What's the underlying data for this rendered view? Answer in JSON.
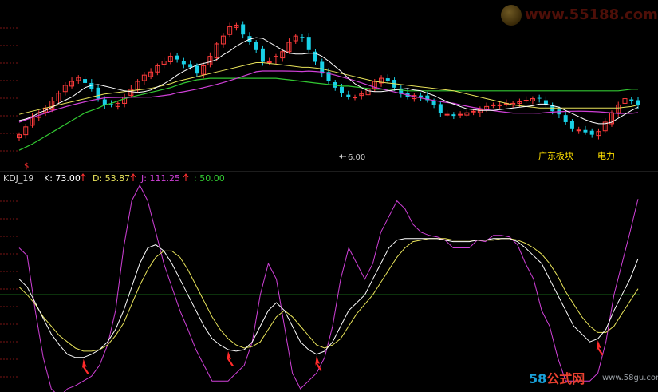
{
  "colors": {
    "background": "#000000",
    "candle_up": "#ff3b3b",
    "candle_down": "#19d0e6",
    "ma_short": "#ffffff",
    "ma_mid": "#e8e35a",
    "ma_long": "#d040d8",
    "ma_very_long": "#32c832",
    "k_line": "#ffffff",
    "d_line": "#e8e35a",
    "j_line": "#d040d8",
    "level_line": "#32c832",
    "arrow": "#ff2a2a",
    "grid": "#7a1414"
  },
  "top_chart": {
    "low_label": "6.00",
    "sector_label": "广东板块",
    "industry_label": "电力",
    "flag_icon": "dollar-flag-icon"
  },
  "kdj_header": {
    "name": "KDJ_19",
    "k_label": "K: 73.00",
    "d_label": "D: 53.87",
    "j_label": "J: 111.25",
    "level_label": ": 50.00",
    "up_arrow_icon": "up-arrow-icon"
  },
  "watermark": {
    "text": "www.55188.com"
  },
  "brand": {
    "num": "58",
    "cn": "公式网",
    "url": "www.58gu.com"
  },
  "chart_data": [
    {
      "type": "candlestick",
      "title": "",
      "xlabel": "",
      "ylabel": "",
      "annotations": [
        "6.00",
        "广东板块",
        "电力"
      ],
      "series": [
        {
          "values": [
            32,
            42,
            55,
            60,
            66,
            75,
            85,
            95,
            100,
            105,
            98,
            90,
            78,
            70,
            70,
            72,
            80,
            90,
            100,
            108,
            112,
            120,
            126,
            132,
            128,
            122,
            118,
            110,
            120,
            132,
            148,
            158,
            170,
            172,
            160,
            150,
            140,
            125,
            125,
            132,
            138,
            150,
            158,
            156,
            140,
            125,
            110,
            100,
            92,
            85,
            80,
            80,
            84,
            90,
            100,
            104,
            100,
            92,
            84,
            80,
            82,
            80,
            76,
            70,
            60,
            58,
            56,
            58,
            60,
            62,
            64,
            68,
            70,
            70,
            72,
            72,
            74,
            76,
            78,
            78,
            70,
            62,
            58,
            48,
            40,
            38,
            35,
            32,
            36,
            48,
            60,
            70,
            78,
            75,
            70
          ]
        },
        {
          "values": [
            50,
            52,
            55,
            60,
            63,
            67,
            72,
            76,
            80,
            86,
            92,
            95,
            96,
            94,
            92,
            90,
            88,
            87,
            86,
            87,
            89,
            93,
            97,
            102,
            108,
            113,
            117,
            121,
            123,
            125,
            128,
            134,
            139,
            145,
            150,
            154,
            156,
            155,
            150,
            145,
            140,
            136,
            135,
            135,
            136,
            136,
            132,
            126,
            119,
            112,
            104,
            97,
            92,
            88,
            87,
            87,
            88,
            89,
            90,
            91,
            89,
            88,
            85,
            82,
            78,
            74,
            71,
            68,
            65,
            64,
            63,
            63,
            63,
            64,
            65,
            66,
            67,
            68,
            69,
            71,
            71,
            69,
            67,
            63,
            59,
            55,
            51,
            48,
            46,
            46,
            48,
            53,
            58,
            63,
            67
          ]
        },
        {
          "values": [
            58,
            60,
            62,
            64,
            66,
            68,
            70,
            72,
            74,
            76,
            78,
            80,
            82,
            84,
            85,
            86,
            87,
            88,
            89,
            90,
            91,
            93,
            95,
            97,
            100,
            102,
            104,
            106,
            108,
            110,
            112,
            114,
            116,
            118,
            120,
            122,
            124,
            124,
            123,
            122,
            121,
            120,
            119,
            118,
            118,
            117,
            116,
            114,
            112,
            110,
            108,
            106,
            104,
            102,
            100,
            99,
            98,
            97,
            96,
            95,
            94,
            93,
            92,
            91,
            90,
            89,
            88,
            86,
            84,
            82,
            80,
            78,
            76,
            74,
            72,
            70,
            69,
            68,
            67,
            66,
            66,
            66,
            66,
            66,
            66,
            66,
            66,
            66,
            66,
            66,
            66,
            66,
            67,
            68,
            70
          ]
        },
        {
          "values": [
            12,
            16,
            20,
            25,
            30,
            35,
            40,
            45,
            50,
            55,
            60,
            63,
            66,
            70,
            72,
            75,
            78,
            80,
            82,
            84,
            86,
            88,
            90,
            92,
            95,
            98,
            100,
            102,
            103,
            104,
            104,
            104,
            104,
            104,
            104,
            104,
            104,
            104,
            104,
            104,
            103,
            102,
            101,
            100,
            99,
            98,
            97,
            96,
            95,
            94,
            94,
            93,
            92,
            91,
            90,
            90,
            90,
            90,
            89,
            88,
            88,
            88,
            88,
            88,
            88,
            88,
            88,
            88,
            88,
            88,
            88,
            88,
            88,
            88,
            88,
            88,
            88,
            88,
            88,
            88,
            88,
            88,
            88,
            88,
            88,
            88,
            88,
            88,
            88,
            88,
            88,
            88,
            89,
            90,
            90
          ]
        }
      ]
    },
    {
      "type": "line",
      "title": "",
      "xlabel": "",
      "ylabel": "",
      "ylim": [
        -10,
        120
      ],
      "annotations": [
        "KDJ_19",
        "K: 73.00",
        "D: 53.87",
        "J: 111.25",
        ": 50.00"
      ],
      "series": [
        {
          "name": "K",
          "values": [
            60,
            55,
            45,
            35,
            25,
            18,
            12,
            10,
            10,
            12,
            15,
            20,
            28,
            40,
            55,
            70,
            80,
            82,
            78,
            70,
            60,
            50,
            40,
            30,
            22,
            18,
            15,
            14,
            15,
            20,
            30,
            40,
            45,
            40,
            30,
            20,
            15,
            12,
            14,
            20,
            30,
            40,
            45,
            50,
            60,
            70,
            80,
            85,
            86,
            86,
            86,
            86,
            86,
            85,
            84,
            84,
            84,
            85,
            85,
            86,
            86,
            86,
            84,
            80,
            75,
            70,
            60,
            50,
            40,
            30,
            25,
            20,
            22,
            28,
            40,
            50,
            60,
            73
          ]
        },
        {
          "name": "D",
          "values": [
            55,
            50,
            44,
            36,
            30,
            24,
            20,
            16,
            14,
            14,
            15,
            18,
            24,
            32,
            44,
            56,
            66,
            74,
            78,
            78,
            74,
            66,
            56,
            46,
            36,
            28,
            22,
            18,
            16,
            17,
            20,
            28,
            36,
            40,
            36,
            30,
            24,
            18,
            16,
            18,
            22,
            30,
            38,
            44,
            50,
            58,
            66,
            74,
            80,
            84,
            85,
            86,
            86,
            86,
            85,
            85,
            85,
            85,
            85,
            85,
            86,
            86,
            85,
            83,
            80,
            76,
            70,
            62,
            52,
            44,
            36,
            30,
            26,
            26,
            30,
            38,
            46,
            53.87
          ]
        },
        {
          "name": "J",
          "values": [
            80,
            75,
            40,
            10,
            -10,
            -15,
            -10,
            -8,
            -5,
            -2,
            5,
            18,
            40,
            80,
            110,
            120,
            110,
            90,
            70,
            55,
            40,
            28,
            15,
            5,
            -5,
            -5,
            -5,
            0,
            5,
            20,
            50,
            70,
            60,
            30,
            0,
            -10,
            -5,
            0,
            10,
            30,
            60,
            80,
            70,
            60,
            70,
            90,
            100,
            110,
            105,
            95,
            90,
            88,
            87,
            85,
            80,
            80,
            80,
            85,
            84,
            88,
            88,
            87,
            82,
            70,
            60,
            40,
            30,
            10,
            -5,
            -5,
            -5,
            -5,
            0,
            20,
            50,
            70,
            90,
            111.25
          ]
        },
        {
          "name": "",
          "values": [
            50,
            50
          ]
        }
      ]
    }
  ]
}
